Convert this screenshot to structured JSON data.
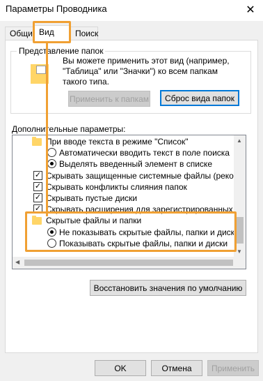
{
  "window": {
    "title": "Параметры Проводника"
  },
  "tabs": [
    {
      "label": "Общие",
      "active": false
    },
    {
      "label": "Вид",
      "active": true
    },
    {
      "label": "Поиск",
      "active": false
    }
  ],
  "folder_view": {
    "title": "Представление папок",
    "description": "Вы можете применить этот вид (например, \"Таблица\" или \"Значки\") ко всем папкам такого типа.",
    "apply_button": "Применить к папкам",
    "reset_button": "Сброс вида папок"
  },
  "advanced": {
    "label": "Дополнительные параметры:",
    "items": [
      {
        "type": "folder",
        "label": "При вводе текста в режиме \"Список\"",
        "indent": 0
      },
      {
        "type": "radio",
        "label": "Автоматически вводить текст в поле поиска",
        "checked": false,
        "indent": 1
      },
      {
        "type": "radio",
        "label": "Выделять введенный элемент в списке",
        "checked": true,
        "indent": 1
      },
      {
        "type": "checkbox",
        "label": "Скрывать защищенные системные файлы (рекомен",
        "checked": true,
        "indent": 0
      },
      {
        "type": "checkbox",
        "label": "Скрывать конфликты слияния папок",
        "checked": true,
        "indent": 0
      },
      {
        "type": "checkbox",
        "label": "Скрывать пустые диски",
        "checked": true,
        "indent": 0
      },
      {
        "type": "checkbox",
        "label": "Скрывать расширения для зарегистрированных типо",
        "checked": true,
        "indent": 0
      },
      {
        "type": "folder",
        "label": "Скрытые файлы и папки",
        "indent": 0
      },
      {
        "type": "radio",
        "label": "Не показывать скрытые файлы, папки и диски",
        "checked": true,
        "indent": 1
      },
      {
        "type": "radio",
        "label": "Показывать скрытые файлы, папки и диски",
        "checked": false,
        "indent": 1
      }
    ],
    "restore_button": "Восстановить значения по умолчанию"
  },
  "footer": {
    "ok": "OK",
    "cancel": "Отмена",
    "apply": "Применить"
  },
  "colors": {
    "highlight": "#f0a033",
    "focus": "#0078d7",
    "folder": "#ffd567"
  }
}
